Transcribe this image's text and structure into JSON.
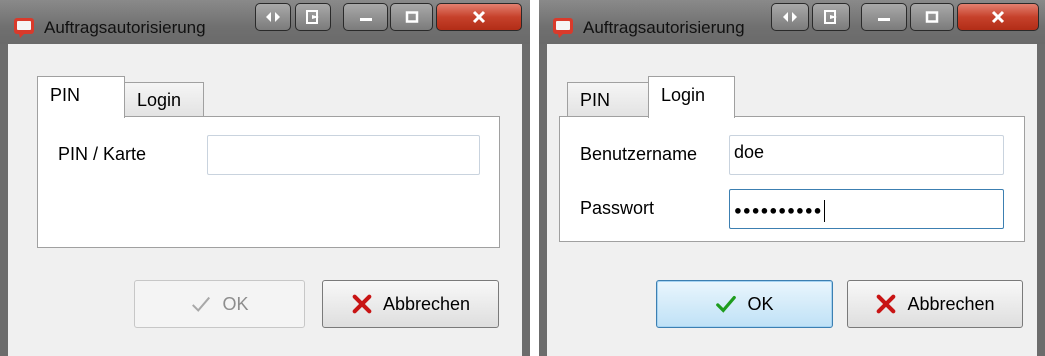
{
  "dialogs": [
    {
      "title": "Auftragsautorisierung",
      "tabs": [
        {
          "label": "PIN",
          "active": true
        },
        {
          "label": "Login",
          "active": false
        }
      ],
      "fields": [
        {
          "label": "PIN / Karte",
          "value": ""
        }
      ],
      "buttons": {
        "ok": "OK",
        "ok_enabled": false,
        "cancel": "Abbrechen"
      }
    },
    {
      "title": "Auftragsautorisierung",
      "tabs": [
        {
          "label": "PIN",
          "active": false
        },
        {
          "label": "Login",
          "active": true
        }
      ],
      "fields": [
        {
          "label": "Benutzername",
          "value": "doe"
        },
        {
          "label": "Passwort",
          "value": "●●●●●●●●●●"
        }
      ],
      "buttons": {
        "ok": "OK",
        "ok_enabled": true,
        "cancel": "Abbrechen"
      }
    }
  ],
  "icons": {
    "titlebar": [
      "app-icon",
      "move-icon",
      "exit-icon",
      "minimize-icon",
      "maximize-icon",
      "close-icon"
    ],
    "ok": "checkmark-icon",
    "cancel": "cross-icon"
  },
  "colors": {
    "frame": "#6c6c6c",
    "close_button": "#c6412b",
    "check_enabled": "#1e9c1e",
    "check_disabled": "#a8a8a8",
    "cancel_cross": "#c81414",
    "focus_border": "#3c7fb1"
  }
}
